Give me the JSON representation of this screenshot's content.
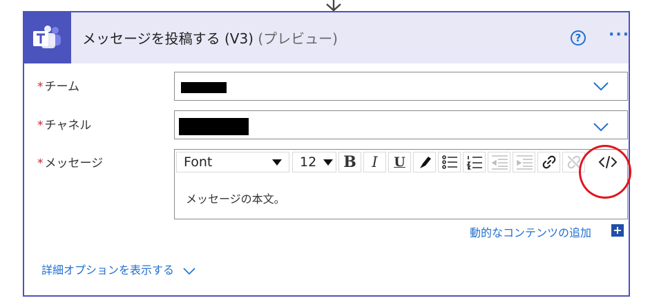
{
  "action": {
    "title": "メッセージを投稿する (V3)",
    "title_suffix": "(プレビュー)"
  },
  "fields": {
    "team": {
      "required_mark": "*",
      "label": "チーム"
    },
    "channel": {
      "required_mark": "*",
      "label": "チャネル"
    },
    "message": {
      "required_mark": "*",
      "label": "メッセージ",
      "body": "メッセージの本文。"
    }
  },
  "toolbar": {
    "font_label": "Font",
    "size_label": "12",
    "bold": "B",
    "italic": "I",
    "underline": "U"
  },
  "links": {
    "add_dynamic": "動的なコンテンツの追加",
    "add_dynamic_plus": "+",
    "show_advanced": "詳細オプションを表示する"
  },
  "header_buttons": {
    "help": "?",
    "more": "···"
  },
  "colors": {
    "accent": "#1f6fd1",
    "teams": "#4b53bc",
    "required": "#c4262e",
    "annotation": "#e0141d"
  },
  "icons": [
    "teams-icon",
    "help-icon",
    "more-icon",
    "chevron-down-icon",
    "pen-icon",
    "bullet-list-icon",
    "numbered-list-icon",
    "decrease-indent-icon",
    "increase-indent-icon",
    "link-icon",
    "unlink-icon",
    "code-view-icon",
    "plus-icon",
    "arrow-down-icon"
  ]
}
